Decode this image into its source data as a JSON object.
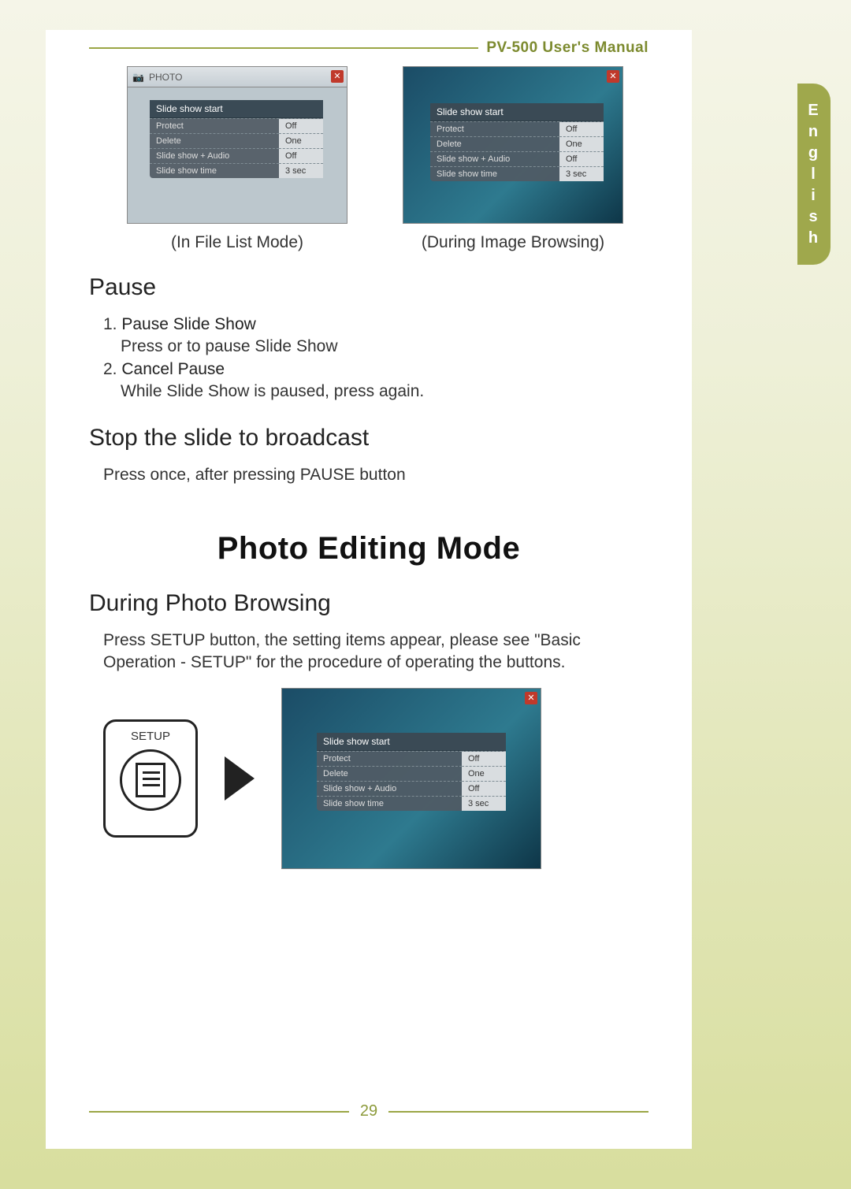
{
  "header": {
    "manual_title": "PV-500 User's Manual"
  },
  "side_tab": {
    "letters": [
      "E",
      "n",
      "g",
      "l",
      "i",
      "s",
      "h"
    ]
  },
  "screenshots": {
    "left": {
      "title_bar": "PHOTO",
      "menu_header": "Slide show start",
      "rows": [
        {
          "label": "Protect",
          "value": "Off"
        },
        {
          "label": "Delete",
          "value": "One"
        },
        {
          "label": "Slide show + Audio",
          "value": "Off"
        },
        {
          "label": "Slide show time",
          "value": "3 sec"
        }
      ],
      "caption": "(In File List Mode)"
    },
    "right": {
      "menu_header": "Slide show start",
      "rows": [
        {
          "label": "Protect",
          "value": "Off"
        },
        {
          "label": "Delete",
          "value": "One"
        },
        {
          "label": "Slide show + Audio",
          "value": "Off"
        },
        {
          "label": "Slide show time",
          "value": "3 sec"
        }
      ],
      "caption": "(During Image Browsing)"
    }
  },
  "pause": {
    "heading": "Pause",
    "items": [
      {
        "num": "1.",
        "title": "Pause Slide Show",
        "text": "Press      or    to pause Slide Show"
      },
      {
        "num": "2.",
        "title": "Cancel Pause",
        "text": "While Slide Show is paused, press       again."
      }
    ]
  },
  "stop": {
    "heading": "Stop the slide to broadcast",
    "text": "Press    once, after pressing PAUSE button"
  },
  "photo_editing": {
    "heading": "Photo Editing Mode",
    "sub": "During Photo Browsing",
    "text": "Press SETUP button, the setting items appear, please see \"Basic Operation - SETUP\" for the procedure of operating the buttons.",
    "setup_label": "SETUP",
    "screenshot": {
      "menu_header": "Slide show start",
      "rows": [
        {
          "label": "Protect",
          "value": "Off"
        },
        {
          "label": "Delete",
          "value": "One"
        },
        {
          "label": "Slide show + Audio",
          "value": "Off"
        },
        {
          "label": "Slide show time",
          "value": "3 sec"
        }
      ]
    }
  },
  "page_number": "29"
}
